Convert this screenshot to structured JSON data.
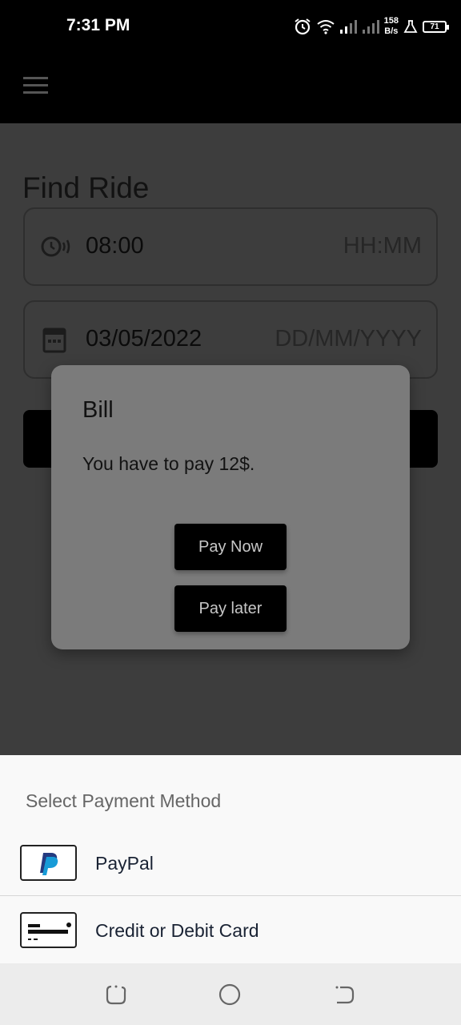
{
  "status_bar": {
    "time": "7:31 PM",
    "network_speed_value": "158",
    "network_speed_unit": "B/s",
    "battery": "71",
    "icons": [
      "alarm-icon",
      "wifi-icon",
      "signal-icon",
      "signal-icon",
      "flask-icon",
      "battery-icon"
    ]
  },
  "app_bar": {
    "menu_icon": "menu-icon"
  },
  "page": {
    "title": "Find Ride",
    "time_field": {
      "value": "08:00",
      "hint": "HH:MM",
      "icon": "clock-icon"
    },
    "date_field": {
      "value": "03/05/2022",
      "hint": "DD/MM/YYYY",
      "icon": "calendar-icon"
    }
  },
  "dialog": {
    "title": "Bill",
    "message": "You have to pay 12$.",
    "pay_now_label": "Pay Now",
    "pay_later_label": "Pay later"
  },
  "payment_sheet": {
    "title": "Select Payment Method",
    "options": [
      {
        "label": "PayPal",
        "icon": "paypal-icon"
      },
      {
        "label": "Credit or Debit Card",
        "icon": "credit-card-icon"
      }
    ]
  },
  "nav_bar": {
    "buttons": [
      "recents-icon",
      "home-icon",
      "back-icon"
    ]
  }
}
